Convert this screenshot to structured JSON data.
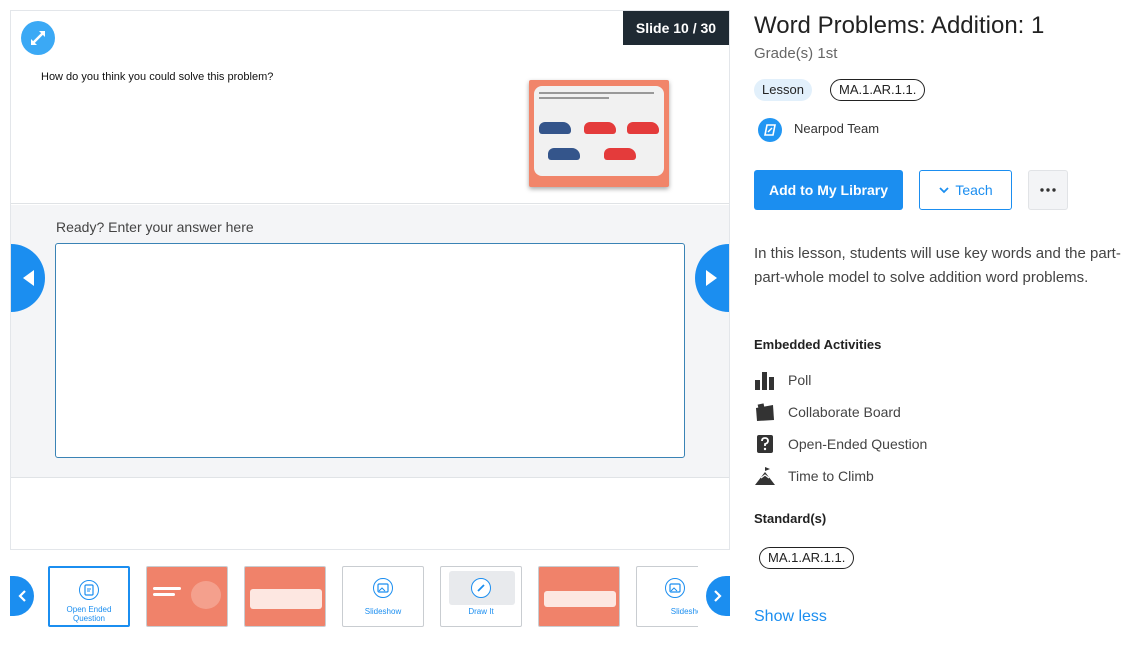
{
  "preview": {
    "slide_counter": "Slide 10 / 30",
    "question": "How do you think you could solve this problem?",
    "answer_label": "Ready? Enter your answer here",
    "answer_value": ""
  },
  "thumbnails": [
    {
      "label": "Open Ended Question",
      "icon": "open-ended-question-icon",
      "active": true
    },
    {
      "label": "",
      "icon": "",
      "active": false
    },
    {
      "label": "",
      "icon": "",
      "active": false
    },
    {
      "label": "Slideshow",
      "icon": "slideshow-icon",
      "active": false
    },
    {
      "label": "Draw It",
      "icon": "draw-it-icon",
      "active": false
    },
    {
      "label": "",
      "icon": "",
      "active": false
    },
    {
      "label": "Slideshow",
      "icon": "slideshow-icon",
      "active": false
    }
  ],
  "lesson": {
    "title": "Word Problems: Addition: 1",
    "grade": "Grade(s) 1st",
    "type_badge": "Lesson",
    "standard_badge": "MA.1.AR.1.1.",
    "author": "Nearpod Team",
    "add_button": "Add to My Library",
    "teach_button": "Teach",
    "description": "In this lesson, students will use key words and the part-part-whole model to solve addition word problems.",
    "embedded_title": "Embedded Activities",
    "activities": [
      {
        "label": "Poll",
        "icon": "poll-icon"
      },
      {
        "label": "Collaborate Board",
        "icon": "collaborate-board-icon"
      },
      {
        "label": "Open-Ended Question",
        "icon": "open-ended-question-icon"
      },
      {
        "label": "Time to Climb",
        "icon": "time-to-climb-icon"
      }
    ],
    "standards_title": "Standard(s)",
    "standards": [
      "MA.1.AR.1.1."
    ],
    "show_less": "Show less"
  },
  "colors": {
    "accent": "#1b8ef0",
    "counter_bg": "#1f2a33",
    "slide_orange": "#f0826a"
  }
}
